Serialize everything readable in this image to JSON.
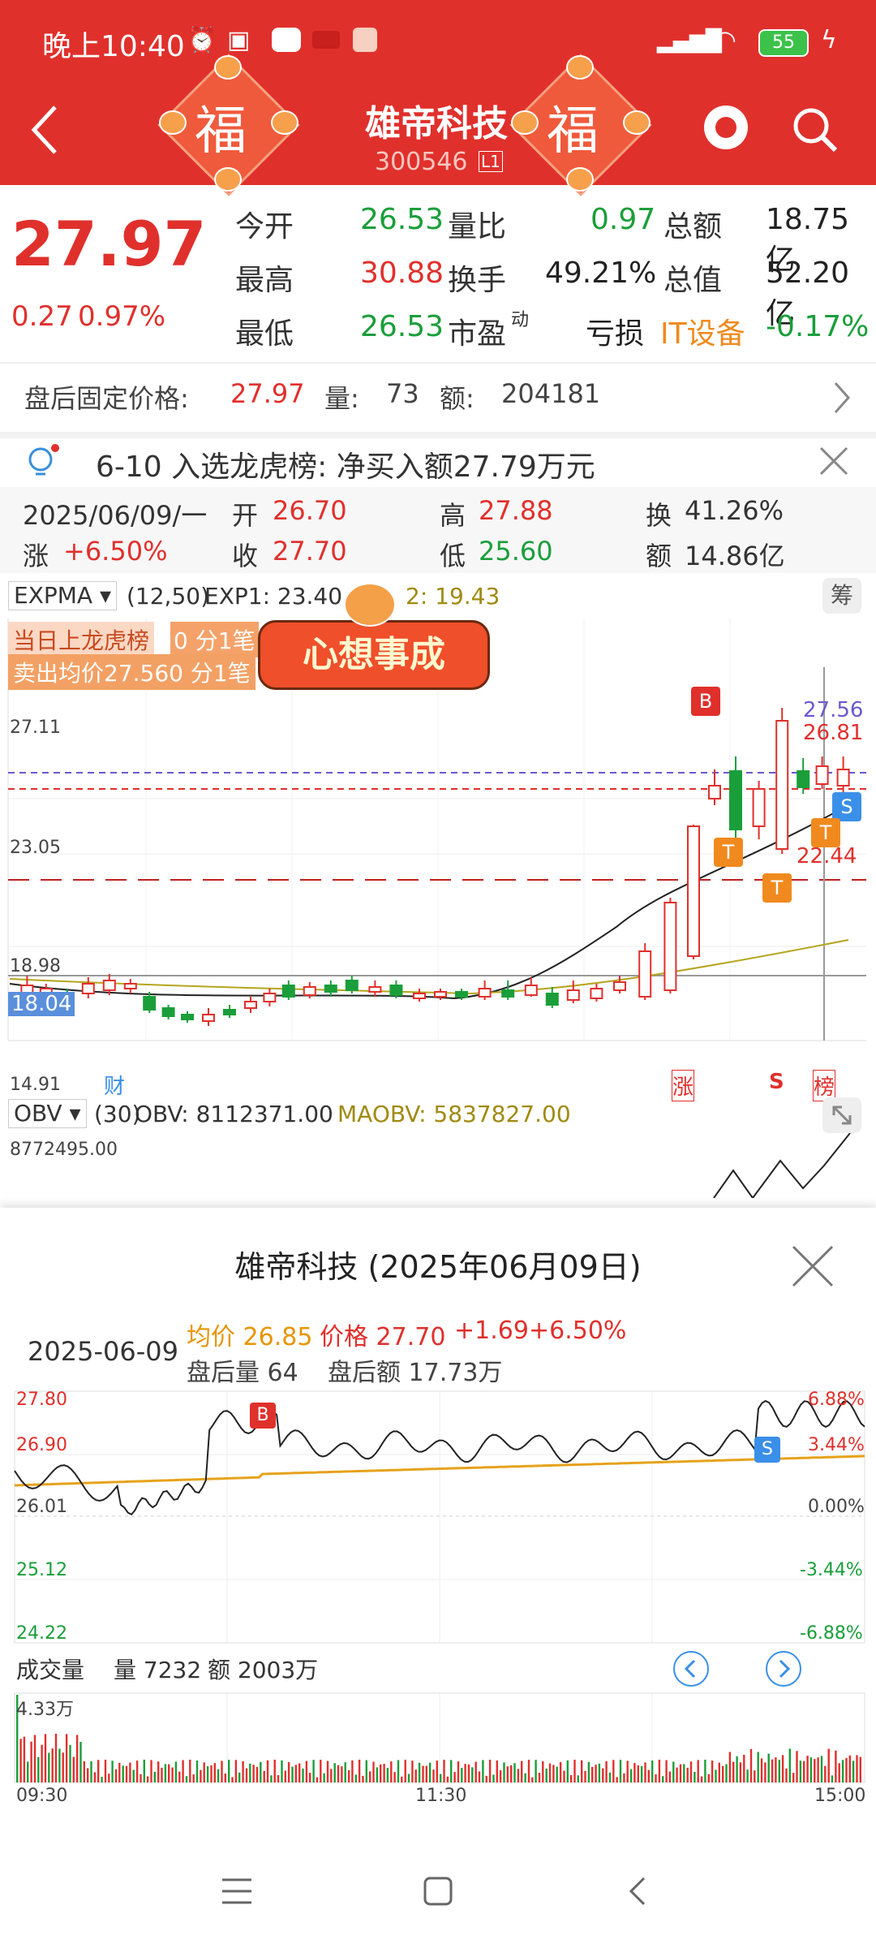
{
  "status_bar": {
    "time": "晚上10:40",
    "battery": "55"
  },
  "header": {
    "title": "雄帝科技",
    "code": "300546",
    "badge": "L1",
    "fu": "福"
  },
  "quote": {
    "price": "27.97",
    "change": "0.27",
    "change_pct": "0.97%",
    "rows": [
      {
        "l1": "今开",
        "v1": "26.53",
        "l2": "量比",
        "v2": "0.97",
        "l3": "总额",
        "v3": "18.75亿"
      },
      {
        "l1": "最高",
        "v1": "30.88",
        "l2": "换手",
        "v2": "49.21%",
        "l3": "总值",
        "v3": "52.20亿"
      },
      {
        "l1": "最低",
        "v1": "26.53",
        "l2": "市盈",
        "l2sup": "动",
        "v2": "亏损",
        "l3": "IT设备",
        "v3": "-0.17%"
      }
    ]
  },
  "after_hours": {
    "label": "盘后固定价格:",
    "price": "27.97",
    "vol_label": "量:",
    "vol": "73",
    "amt_label": "额:",
    "amt": "204181"
  },
  "notice": {
    "text": "6-10 入选龙虎榜: 净买入额27.79万元"
  },
  "day_info": {
    "date": "2025/06/09/一",
    "open_l": "开",
    "open": "26.70",
    "high_l": "高",
    "high": "27.88",
    "turn_l": "换",
    "turn": "41.26%",
    "chg_l": "涨",
    "chg": "+6.50%",
    "close_l": "收",
    "close": "27.70",
    "low_l": "低",
    "low": "25.60",
    "amt_l": "额",
    "amt": "14.86亿"
  },
  "kchart": {
    "indicator": "EXPMA",
    "params": "(12,50)",
    "exp1": "EXP1: 23.40",
    "exp2": "2: 19.43",
    "chou": "筹",
    "tag1": "当日上龙虎榜",
    "tag1b": "0 分1笔",
    "tag2": "卖出均价27.560 分1笔",
    "banner": "心想事成",
    "levels": [
      "27.11",
      "23.05",
      "18.98",
      "14.91"
    ],
    "cur_level": "18.04",
    "right_labels": [
      "27.56",
      "26.81",
      "22.44"
    ],
    "markers": {
      "b": "B",
      "s": "S",
      "t": "T",
      "cai": "财",
      "zhang": "涨",
      "s2": "S",
      "bang": "榜"
    }
  },
  "obv": {
    "name": "OBV",
    "params": "(30)",
    "obv": "OBV: 8112371.00",
    "maobv": "MAOBV: 5837827.00",
    "top": "8772495.00"
  },
  "popup": {
    "title": "雄帝科技 (2025年06月09日)",
    "date": "2025-06-09",
    "avg": "均价 26.85",
    "price": "价格 27.70",
    "chg": "+1.69",
    "pct": "+6.50%",
    "ah_vol": "盘后量 64",
    "ah_amt": "盘后额 17.73万",
    "left_axis": [
      "27.80",
      "26.90",
      "26.01",
      "25.12",
      "24.22"
    ],
    "right_axis": [
      "6.88%",
      "3.44%",
      "0.00%",
      "-3.44%",
      "-6.88%"
    ],
    "vol_title": "成交量",
    "vol_val": "量 7232",
    "vol_amt": "额 2003万",
    "vol_top": "4.33万",
    "times": [
      "09:30",
      "11:30",
      "15:00"
    ],
    "b": "B",
    "s": "S"
  }
}
